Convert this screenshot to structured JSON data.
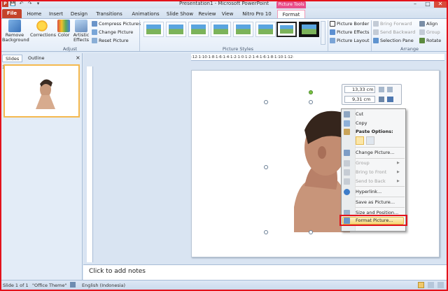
{
  "window": {
    "title": "Presentation1 - Microsoft PowerPoint",
    "context_tab_group": "Picture Tools"
  },
  "qat": {
    "save": "💾",
    "undo": "↶",
    "redo": "↷",
    "more": "▾"
  },
  "window_controls": {
    "minimize": "–",
    "maximize": "□",
    "close": "✕"
  },
  "tabs": [
    "File",
    "Home",
    "Insert",
    "Design",
    "Transitions",
    "Animations",
    "Slide Show",
    "Review",
    "View",
    "Nitro Pro 10",
    "Format"
  ],
  "ribbon": {
    "adjust": {
      "remove_bg": "Remove Background",
      "corrections": "Corrections",
      "color": "Color",
      "artistic": "Artistic Effects",
      "compress": "Compress Pictures",
      "change": "Change Picture",
      "reset": "Reset Picture",
      "label": "Adjust"
    },
    "styles": {
      "label": "Picture Styles"
    },
    "picture_opts": {
      "border": "Picture Border",
      "effects": "Picture Effects",
      "layout": "Picture Layout"
    },
    "arrange": {
      "bring_forward": "Bring Forward",
      "send_backward": "Send Backward",
      "selection_pane": "Selection Pane",
      "align": "Align",
      "group": "Group",
      "rotate": "Rotate",
      "label": "Arrange"
    }
  },
  "panel": {
    "tab_slides": "Slides",
    "tab_outline": "Outline",
    "close": "×",
    "slide_number": "1"
  },
  "ruler": {
    "h": "·12·1·10·1·8·1·6·1·4·1·2·1·0·1·2·1·4·1·6·1·8·1·10·1·12·"
  },
  "mini_toolbar": {
    "height": "13,33 cm",
    "width": "9,31 cm"
  },
  "context_menu": {
    "items": [
      {
        "label": "Cut",
        "enabled": true
      },
      {
        "label": "Copy",
        "enabled": true
      },
      {
        "label": "Paste Options:",
        "enabled": true
      },
      {
        "label": "Change Picture...",
        "enabled": true
      },
      {
        "label": "Group",
        "enabled": false
      },
      {
        "label": "Bring to Front",
        "enabled": false
      },
      {
        "label": "Send to Back",
        "enabled": false
      },
      {
        "label": "Hyperlink...",
        "enabled": true
      },
      {
        "label": "Save as Picture...",
        "enabled": true
      },
      {
        "label": "Size and Position...",
        "enabled": true
      },
      {
        "label": "Format Picture...",
        "enabled": true
      }
    ],
    "submenu_arrow": "▶"
  },
  "notes": {
    "placeholder": "Click to add notes"
  },
  "status": {
    "slide": "Slide 1 of 1",
    "theme": "\"Office Theme\"",
    "language": "English (Indonesia)"
  },
  "colors": {
    "file_tab": "#c4432b",
    "context_tab": "#e94f8b",
    "highlight_border": "#e3121b"
  }
}
